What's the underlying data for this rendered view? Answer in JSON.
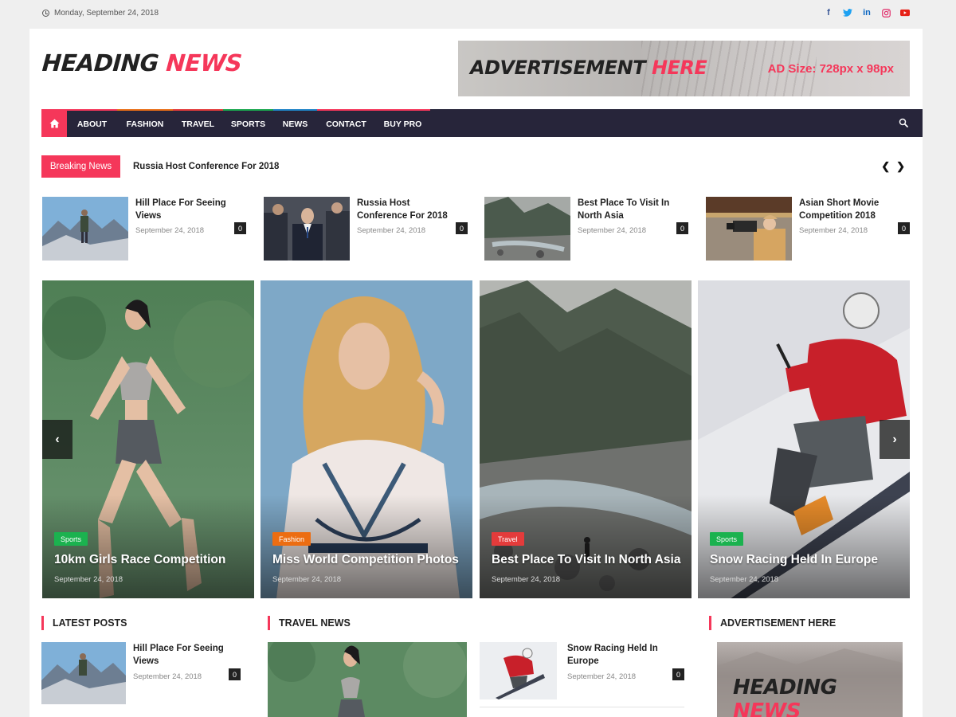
{
  "topbar": {
    "date": "Monday, September 24, 2018",
    "social": [
      "facebook-icon",
      "twitter-icon",
      "linkedin-icon",
      "instagram-icon",
      "youtube-icon"
    ]
  },
  "logo": {
    "part1": "HEADING ",
    "part2": "NEWS"
  },
  "ad_banner": {
    "title_part1": "ADVERTISEMENT ",
    "title_part2": "HERE",
    "size": "AD Size: 728px x 98px"
  },
  "nav": {
    "items": [
      {
        "label": "ABOUT",
        "accent": "#f5375a"
      },
      {
        "label": "FASHION",
        "accent": "#e96e17"
      },
      {
        "label": "TRAVEL",
        "accent": "#e43b3b"
      },
      {
        "label": "SPORTS",
        "accent": "#1aa74f"
      },
      {
        "label": "NEWS",
        "accent": "#1f84c7"
      },
      {
        "label": "CONTACT",
        "accent": "#f5375a"
      },
      {
        "label": "BUY PRO",
        "accent": "#f5375a"
      }
    ]
  },
  "breaking": {
    "label": "Breaking News",
    "headline": "Russia Host Conference For 2018"
  },
  "mini_posts": [
    {
      "title": "Hill Place For Seeing Views",
      "date": "September 24, 2018",
      "comments": "0"
    },
    {
      "title": "Russia Host Conference For 2018",
      "date": "September 24, 2018",
      "comments": "0"
    },
    {
      "title": "Best Place To Visit In North Asia",
      "date": "September 24, 2018",
      "comments": "0"
    },
    {
      "title": "Asian Short Movie Competition 2018",
      "date": "September 24, 2018",
      "comments": "0"
    }
  ],
  "slides": [
    {
      "category": "Sports",
      "cat_color": "#1bb24f",
      "title": "10km Girls Race Competition",
      "date": "September 24, 2018"
    },
    {
      "category": "Fashion",
      "cat_color": "#ec6d12",
      "title": "Miss World Competition Photos",
      "date": "September 24, 2018"
    },
    {
      "category": "Travel",
      "cat_color": "#e43b3b",
      "title": "Best Place To Visit In North Asia",
      "date": "September 24, 2018"
    },
    {
      "category": "Sports",
      "cat_color": "#1bb24f",
      "title": "Snow Racing Held In Europe",
      "date": "September 24, 2018"
    }
  ],
  "sections": {
    "latest": "LATEST POSTS",
    "travel": "TRAVEL NEWS",
    "ad": "ADVERTISEMENT HERE"
  },
  "latest_post": {
    "title": "Hill Place For Seeing Views",
    "date": "September 24, 2018",
    "comments": "0"
  },
  "travel_post": {
    "title": "Snow Racing Held In Europe",
    "date": "September 24, 2018",
    "comments": "0"
  },
  "side_ad": {
    "part1": "HEADING ",
    "part2": "NEWS"
  },
  "colors": {
    "accent": "#f5375a",
    "nav_bg": "#27253a"
  }
}
